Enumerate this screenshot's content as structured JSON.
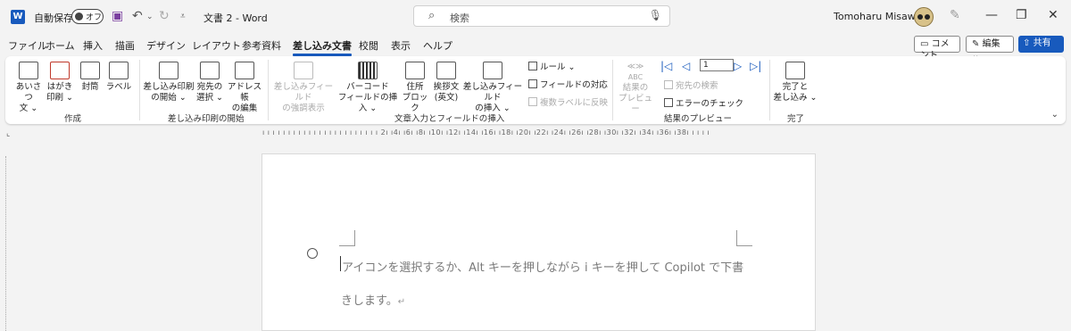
{
  "titlebar": {
    "app_logo": "W",
    "autosave_label": "自動保存",
    "autosave_state": "オフ",
    "doc_title": "文書 2  -  Word",
    "search_placeholder": "検索",
    "user_name": "Tomoharu Misawa",
    "icons": [
      "save-icon",
      "undo-icon",
      "redo-icon",
      "customize-qat-icon",
      "search-icon",
      "microphone-icon",
      "pen-icon",
      "minimize-icon",
      "restore-icon",
      "close-icon"
    ]
  },
  "menu": {
    "tabs": [
      "ファイル",
      "ホーム",
      "挿入",
      "描画",
      "デザイン",
      "レイアウト",
      "参考資料",
      "差し込み文書",
      "校閲",
      "表示",
      "ヘルプ"
    ],
    "active_tab": "差し込み文書",
    "comment_label": "コメント",
    "edit_label": "編集",
    "share_label": "共有"
  },
  "ribbon": {
    "create": {
      "group_label": "作成",
      "envelope_line1": "あいさつ",
      "envelope_line2": "文",
      "postcard_line1": "はがき",
      "postcard_line2": "印刷",
      "envelope_label": "封筒",
      "label_label": "ラベル"
    },
    "start_merge": {
      "group_label": "差し込み印刷の開始",
      "start_line1": "差し込み印刷",
      "start_line2": "の開始",
      "recipients_line1": "宛先の",
      "recipients_line2": "選択",
      "editlist_line1": "アドレス帳",
      "editlist_line2": "の編集"
    },
    "write_insert": {
      "group_label": "文章入力とフィールドの挿入",
      "highlight_line1": "差し込みフィールド",
      "highlight_line2": "の強調表示",
      "barcode_line1": "バーコード",
      "barcode_line2": "フィールドの挿入",
      "address_line1": "住所",
      "address_line2": "ブロック",
      "greeting_line1": "挨拶文",
      "greeting_line2": "(英文)",
      "insert_field_line1": "差し込みフィールド",
      "insert_field_line2": "の挿入",
      "rules_label": "ルール",
      "match_fields_label": "フィールドの対応",
      "update_labels_label": "複数ラベルに反映"
    },
    "preview": {
      "group_label": "結果のプレビュー",
      "abc_label": "ABC",
      "preview_line1": "結果の",
      "preview_line2": "プレビュー",
      "record_number": "1",
      "find_recipient_label": "宛先の検索",
      "check_errors_label": "エラーのチェック"
    },
    "finish": {
      "group_label": "完了",
      "finish_line1": "完了と",
      "finish_line2": "差し込み"
    }
  },
  "ruler": {
    "ticks": "ı ı ı ı ı ı ı ı ı ı ı ı ı ı ı ı ı ı ı ı ı ı ı 2ı ı4ı ı6ı ı8ı ı10ı ı12ı ı14ı ı16ı ı18ı ı20ı ı22ı ı24ı ı26ı ı28ı ı30ı ı32ı ı34ı ı36ı ı38ı ı ı ı ı"
  },
  "document": {
    "hint_line1": "アイコンを選択するか、Alt キーを押しながら i キーを押して Copilot で下書",
    "hint_line2": "きします。"
  }
}
